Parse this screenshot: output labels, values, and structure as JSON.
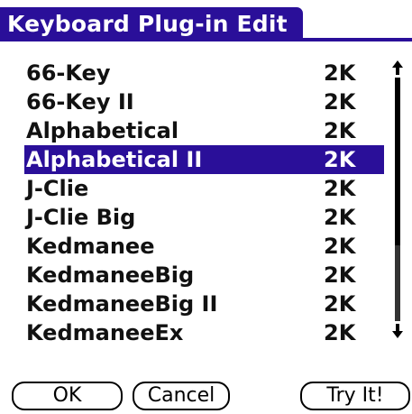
{
  "title": "Keyboard Plug-in Edit",
  "plugins": [
    {
      "name": "66-Key",
      "size": "2K"
    },
    {
      "name": "66-Key II",
      "size": "2K"
    },
    {
      "name": "Alphabetical",
      "size": "2K"
    },
    {
      "name": "Alphabetical II",
      "size": "2K",
      "selected": true
    },
    {
      "name": "J-Clie",
      "size": "2K"
    },
    {
      "name": "J-Clie Big",
      "size": "2K"
    },
    {
      "name": "Kedmanee",
      "size": "2K"
    },
    {
      "name": "KedmaneeBig",
      "size": "2K"
    },
    {
      "name": "KedmaneeBig II",
      "size": "2K"
    },
    {
      "name": "KedmaneeEx",
      "size": "2K"
    }
  ],
  "scrollbar": {
    "up_icon": "arrow-up-icon",
    "down_icon": "arrow-down-icon",
    "thumb_fraction": 0.69,
    "position": "top"
  },
  "buttons": {
    "ok": "OK",
    "cancel": "Cancel",
    "try_it": "Try It!"
  },
  "colors": {
    "accent": "#2a0f99",
    "background": "#ffffff",
    "text": "#111111"
  }
}
